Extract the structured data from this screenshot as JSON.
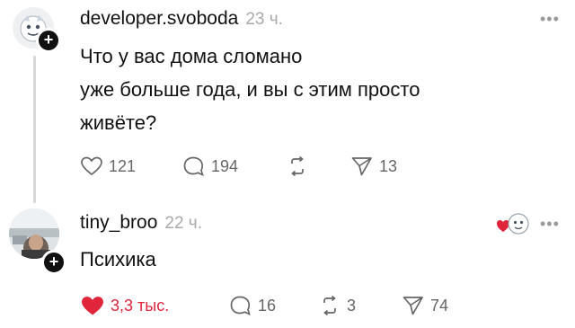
{
  "posts": [
    {
      "username": "developer.svoboda",
      "time": "23 ч.",
      "text_lines": [
        "Что у вас дома сломано",
        "уже больше года, и вы с этим просто",
        "живёте?"
      ],
      "likes": "121",
      "comments": "194",
      "reposts": "",
      "shares": "13"
    },
    {
      "username": "tiny_broo",
      "time": "22 ч.",
      "text_lines": [
        "Психика"
      ],
      "likes": "3,3 тыс.",
      "comments": "16",
      "reposts": "3",
      "shares": "74",
      "liked": true
    }
  ],
  "colors": {
    "accent_like": "#e0243a",
    "muted": "#666666",
    "time": "#a9a9a9"
  },
  "icons": [
    "heart-icon",
    "comment-icon",
    "repost-icon",
    "share-icon",
    "more-icon",
    "plus-icon",
    "reaction-emoji-icon"
  ]
}
